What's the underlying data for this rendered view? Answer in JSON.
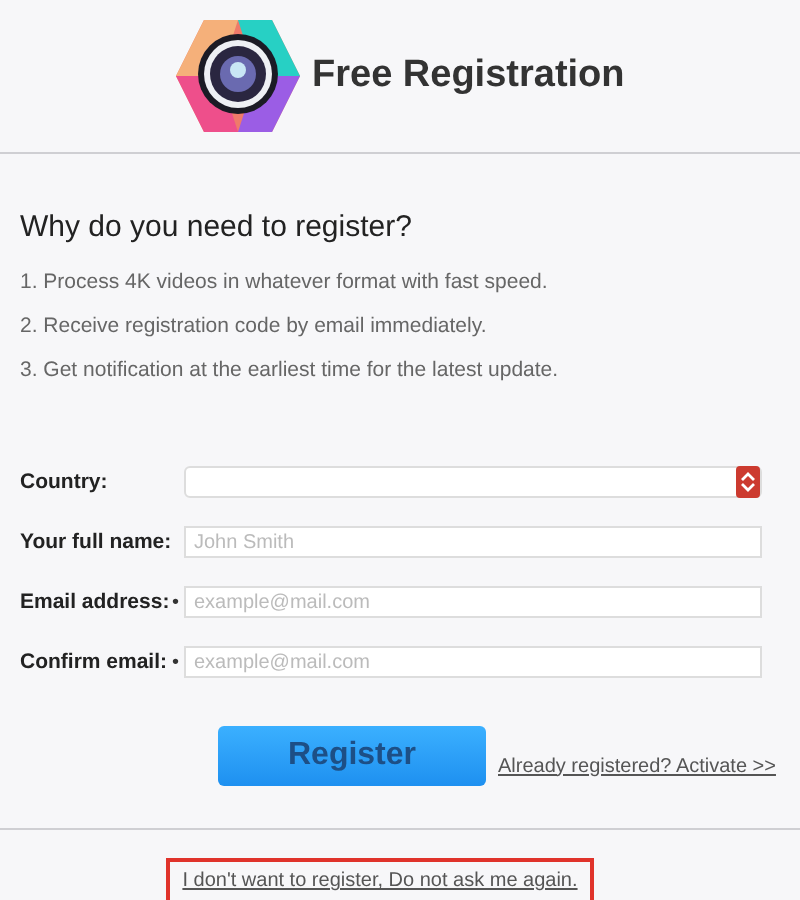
{
  "header": {
    "title": "Free Registration"
  },
  "intro": {
    "heading": "Why do you need to register?",
    "reasons": [
      "1. Process 4K videos in whatever format with fast speed.",
      "2. Receive registration code by email immediately.",
      "3. Get notification at the earliest time for the latest update."
    ]
  },
  "form": {
    "fields": [
      {
        "kind": "select",
        "label": "Country:"
      },
      {
        "kind": "text",
        "label": "Your full name:",
        "placeholder": "John Smith"
      },
      {
        "kind": "text",
        "label": "Email address:",
        "placeholder": "example@mail.com",
        "marker": "•"
      },
      {
        "kind": "text",
        "label": "Confirm email:",
        "placeholder": "example@mail.com",
        "marker": "•"
      }
    ]
  },
  "actions": {
    "register": "Register",
    "activate_link": "Already registered? Activate >>"
  },
  "footer": {
    "decline_link": "I don't want to register, Do not ask me again.",
    "highlighted": true
  }
}
